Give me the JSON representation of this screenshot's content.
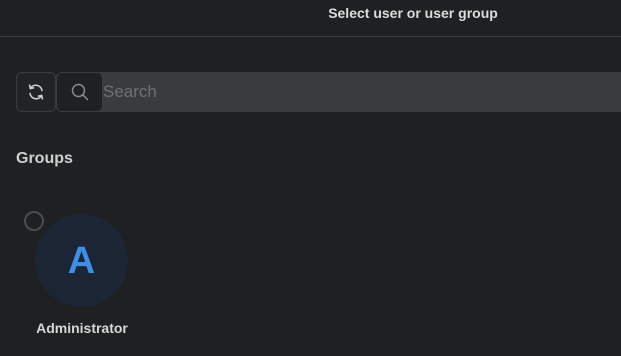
{
  "header": {
    "title": "Select user or user group"
  },
  "toolbar": {
    "refresh_icon": "refresh-icon",
    "search_icon": "search-icon",
    "search": {
      "placeholder": "Search",
      "value": ""
    }
  },
  "groups": {
    "label": "Groups",
    "items": [
      {
        "name": "Administrator",
        "initial": "A",
        "selected": false,
        "avatar_bg": "#1c2533",
        "avatar_fg": "#3d8fe8"
      }
    ]
  },
  "colors": {
    "background": "#1f2022",
    "accent": "#3d8fe8"
  }
}
